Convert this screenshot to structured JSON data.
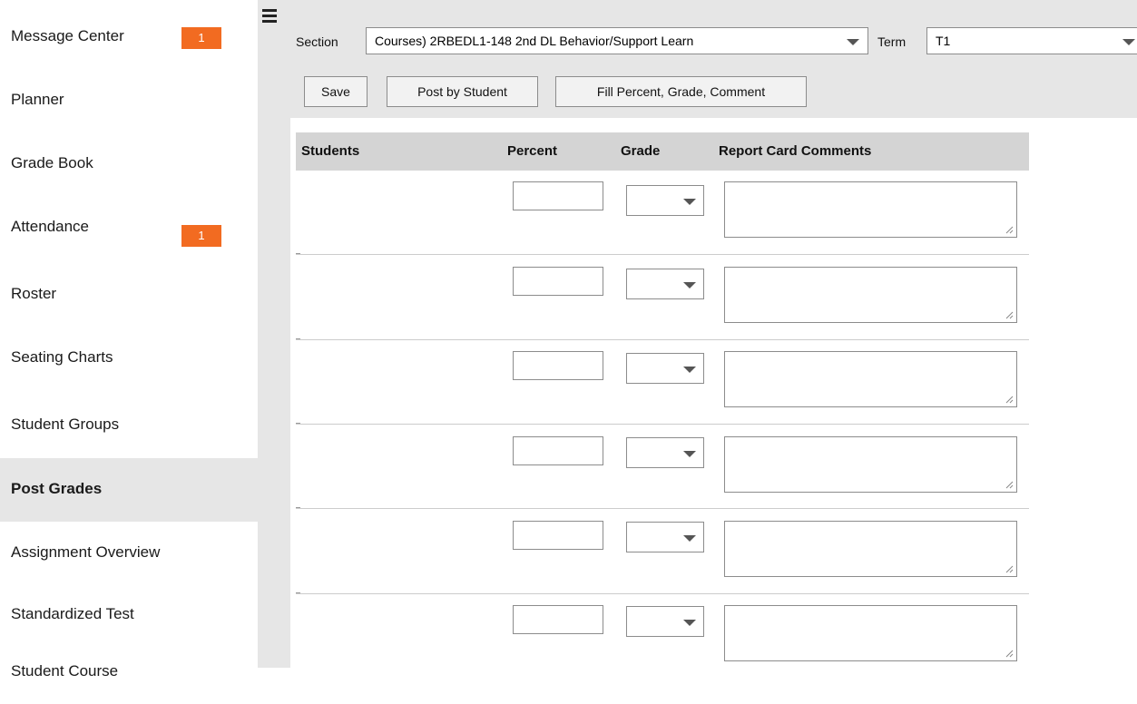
{
  "sidebar": {
    "items": [
      {
        "label": "Message Center",
        "badge": "1"
      },
      {
        "label": "Planner"
      },
      {
        "label": "Grade Book"
      },
      {
        "label": "Attendance",
        "badge": "1"
      },
      {
        "label": "Roster"
      },
      {
        "label": "Seating Charts"
      },
      {
        "label": "Student Groups"
      },
      {
        "label": "Post Grades",
        "active": true
      },
      {
        "label": "Assignment Overview"
      },
      {
        "label": "Standardized Test"
      },
      {
        "label": "Student Course"
      }
    ]
  },
  "header": {
    "section_label": "Section",
    "section_value": "Courses) 2RBEDL1-148 2nd DL Behavior/Support Learn",
    "term_label": "Term",
    "term_value": "T1"
  },
  "toolbar": {
    "save_label": "Save",
    "post_by_student_label": "Post by Student",
    "fill_label": "Fill Percent, Grade, Comment"
  },
  "table": {
    "columns": [
      "Students",
      "Percent",
      "Grade",
      "Report Card Comments"
    ],
    "rows": [
      {
        "percent": "",
        "grade": "",
        "comment": ""
      },
      {
        "percent": "",
        "grade": "",
        "comment": ""
      },
      {
        "percent": "",
        "grade": "",
        "comment": ""
      },
      {
        "percent": "",
        "grade": "",
        "comment": ""
      },
      {
        "percent": "",
        "grade": "",
        "comment": ""
      },
      {
        "percent": "",
        "grade": "",
        "comment": ""
      }
    ]
  },
  "colors": {
    "badge": "#f26b21",
    "panel_gray": "#e6e6e6",
    "header_gray": "#d4d4d4",
    "link_blue": "#4a5fb8"
  },
  "icons": {
    "menu": "hamburger-menu-icon",
    "dropdown": "chevron-down-icon",
    "resize": "resize-grip-icon"
  }
}
